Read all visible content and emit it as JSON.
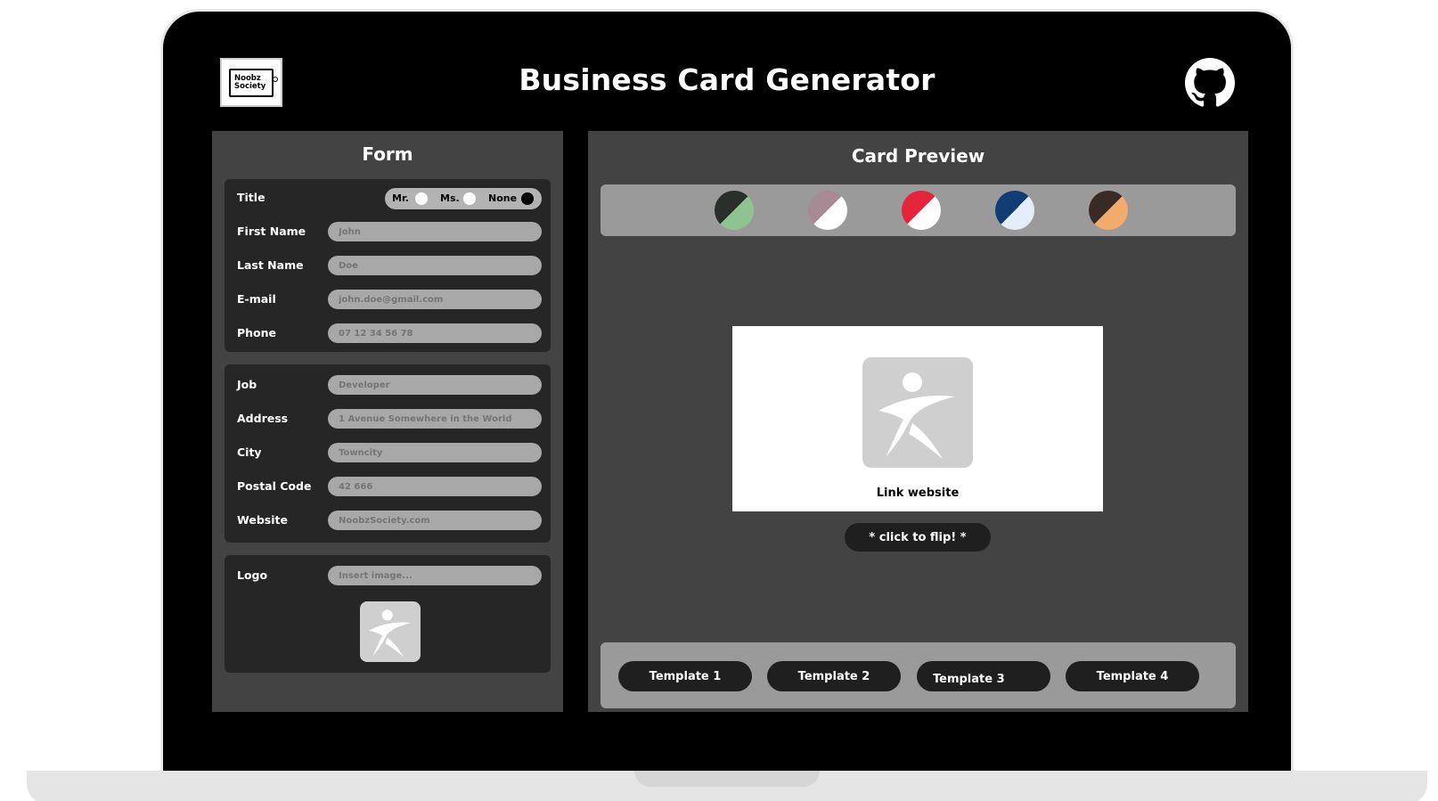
{
  "header": {
    "logo_text_line1": "Noobz",
    "logo_text_line2": "Society",
    "title": "Business Card Generator",
    "github_icon": "github-icon"
  },
  "form": {
    "title": "Form",
    "title_field": {
      "label": "Title",
      "options": [
        "Mr.",
        "Ms.",
        "None"
      ],
      "selected": "None"
    },
    "personal": [
      {
        "label": "First Name",
        "placeholder": "John"
      },
      {
        "label": "Last Name",
        "placeholder": "Doe"
      },
      {
        "label": "E-mail",
        "placeholder": "john.doe@gmail.com"
      },
      {
        "label": "Phone",
        "placeholder": "07 12 34 56 78"
      }
    ],
    "professional": [
      {
        "label": "Job",
        "placeholder": "Developer"
      },
      {
        "label": "Address",
        "placeholder": "1 Avenue Somewhere in the World"
      },
      {
        "label": "City",
        "placeholder": "Towncity"
      },
      {
        "label": "Postal Code",
        "placeholder": "42 666"
      },
      {
        "label": "Website",
        "placeholder": "NoobzSociety.com"
      }
    ],
    "logo": {
      "label": "Logo",
      "placeholder": "Insert image..."
    }
  },
  "preview": {
    "title": "Card Preview",
    "color_themes": [
      {
        "a": "#8fc490",
        "b": "#2a2f2c"
      },
      {
        "a": "#ffffff",
        "b": "#a78a93"
      },
      {
        "a": "#ffffff",
        "b": "#e3243b"
      },
      {
        "a": "#e4eef8",
        "b": "#0f3d74"
      },
      {
        "a": "#f2ab6b",
        "b": "#3a2a26"
      }
    ],
    "card_link": "Link website",
    "flip_label": "* click to flip! *",
    "templates": [
      "Template 1",
      "Template 2",
      "Template 3",
      "Template 4"
    ]
  }
}
